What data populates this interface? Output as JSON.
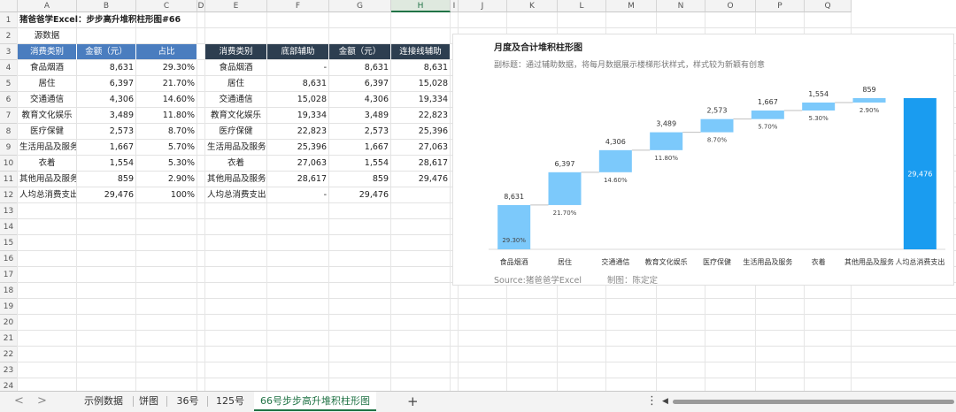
{
  "sheet": {
    "columns": [
      "A",
      "B",
      "C",
      "D",
      "E",
      "F",
      "G",
      "H",
      "I",
      "J",
      "K",
      "L",
      "M",
      "N",
      "O",
      "P",
      "Q"
    ],
    "selected_column": "H",
    "rows": [
      "1",
      "2",
      "3",
      "4",
      "5",
      "6",
      "7",
      "8",
      "9",
      "10",
      "11",
      "12",
      "13",
      "14",
      "15",
      "16",
      "17",
      "18",
      "19",
      "20",
      "21",
      "22",
      "23",
      "24"
    ],
    "title": "猪爸爸学Excel：步步高升堆积柱形图#66",
    "source_label": "源数据",
    "table1": {
      "headers": [
        "消费类别",
        "金额（元）",
        "占比"
      ],
      "rows": [
        [
          "食品烟酒",
          "8,631",
          "29.30%"
        ],
        [
          "居住",
          "6,397",
          "21.70%"
        ],
        [
          "交通通信",
          "4,306",
          "14.60%"
        ],
        [
          "教育文化娱乐",
          "3,489",
          "11.80%"
        ],
        [
          "医疗保健",
          "2,573",
          "8.70%"
        ],
        [
          "生活用品及服务",
          "1,667",
          "5.70%"
        ],
        [
          "衣着",
          "1,554",
          "5.30%"
        ],
        [
          "其他用品及服务",
          "859",
          "2.90%"
        ],
        [
          "人均总消费支出",
          "29,476",
          "100%"
        ]
      ]
    },
    "table2": {
      "headers": [
        "消费类别",
        "底部辅助",
        "金额（元）",
        "连接线辅助"
      ],
      "rows": [
        [
          "食品烟酒",
          "-",
          "8,631",
          "8,631"
        ],
        [
          "居住",
          "8,631",
          "6,397",
          "15,028"
        ],
        [
          "交通通信",
          "15,028",
          "4,306",
          "19,334"
        ],
        [
          "教育文化娱乐",
          "19,334",
          "3,489",
          "22,823"
        ],
        [
          "医疗保健",
          "22,823",
          "2,573",
          "25,396"
        ],
        [
          "生活用品及服务",
          "25,396",
          "1,667",
          "27,063"
        ],
        [
          "衣着",
          "27,063",
          "1,554",
          "28,617"
        ],
        [
          "其他用品及服务",
          "28,617",
          "859",
          "29,476"
        ],
        [
          "人均总消费支出",
          "-",
          "29,476",
          ""
        ]
      ]
    }
  },
  "chart": {
    "title": "月度及合计堆积柱形图",
    "subtitle": "副标题：通过辅助数据，将每月数据展示楼梯形状样式，样式较为新颖有创意",
    "source": "Source:猪爸爸学Excel",
    "author": "制图：陈定定",
    "colors": {
      "step": "#7cc9fb",
      "total": "#1a9cf0",
      "connector": "#bfbfbf"
    }
  },
  "chart_data": {
    "type": "bar",
    "stacked": true,
    "categories": [
      "食品烟酒",
      "居住",
      "交通通信",
      "教育文化娱乐",
      "医疗保健",
      "生活用品及服务",
      "衣着",
      "其他用品及服务",
      "人均总消费支出"
    ],
    "series": [
      {
        "values": [
          0,
          8631,
          15028,
          19334,
          22823,
          25396,
          27063,
          28617,
          0
        ]
      },
      {
        "values": [
          8631,
          6397,
          4306,
          3489,
          2573,
          1667,
          1554,
          859,
          29476
        ]
      }
    ],
    "value_labels": [
      "8,631",
      "6,397",
      "4,306",
      "3,489",
      "2,573",
      "1,667",
      "1,554",
      "859",
      "29,476"
    ],
    "pct_labels": [
      "29.30%",
      "21.70%",
      "14.60%",
      "11.80%",
      "8.70%",
      "5.70%",
      "5.30%",
      "2.90%",
      ""
    ],
    "ylim": [
      0,
      29476
    ],
    "grid": false,
    "legend": "none"
  },
  "tabs": {
    "prev": "<",
    "next": ">",
    "items": [
      "示例数据",
      "饼图",
      "36号",
      "125号",
      "66号步步高升堆积柱形图"
    ],
    "active_index": 4,
    "add": "+",
    "more": "⋮",
    "scroll_left": "◀"
  }
}
